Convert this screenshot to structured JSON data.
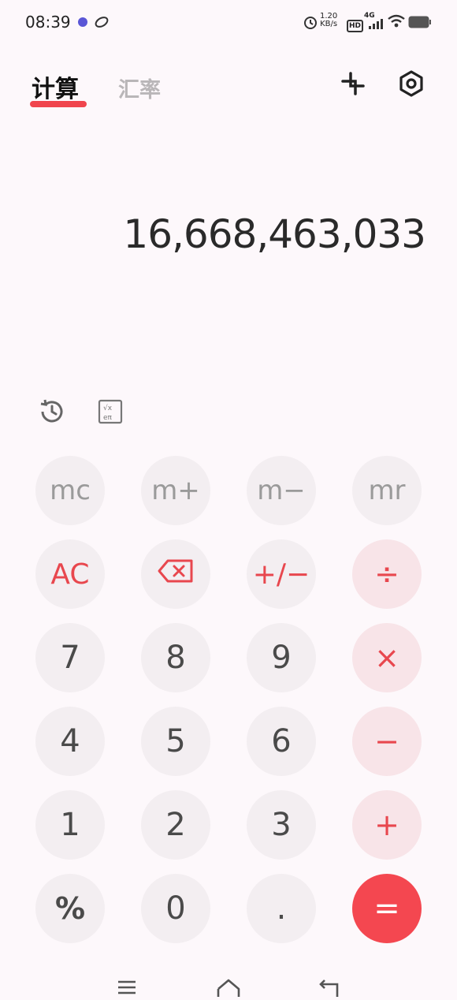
{
  "status_bar": {
    "time": "08:39",
    "speed_value": "1.20",
    "speed_unit": "KB/s",
    "hd_badge": "HD",
    "network": "4G",
    "icons": [
      "notification-app-icon",
      "orbit-app-icon",
      "alarm-icon",
      "signal-icon",
      "wifi-icon",
      "battery-icon"
    ]
  },
  "tabs": {
    "active": "计算",
    "inactive": "汇率"
  },
  "toolbar": {
    "icons": [
      "crop-plus-icon",
      "settings-hex-icon"
    ]
  },
  "display": {
    "value": "16,668,463,033"
  },
  "tools": {
    "icons": [
      "history-icon",
      "scientific-icon"
    ]
  },
  "keypad": {
    "rows": [
      [
        "mc",
        "m+",
        "m−",
        "mr"
      ],
      [
        "AC",
        "",
        "+/−",
        "÷"
      ],
      [
        "7",
        "8",
        "9",
        "×"
      ],
      [
        "4",
        "5",
        "6",
        "−"
      ],
      [
        "1",
        "2",
        "3",
        "+"
      ],
      [
        "%",
        "0",
        ".",
        "="
      ]
    ],
    "backspace_icon": "backspace-icon"
  },
  "colors": {
    "accent": "#f0454d",
    "equals_bg": "#f44750",
    "operator_bg": "#f8e4e8",
    "key_bg": "#f3eef1",
    "background": "#fdf8fb"
  },
  "nav_bar": {
    "icons": [
      "menu-icon",
      "home-icon",
      "back-icon"
    ]
  }
}
